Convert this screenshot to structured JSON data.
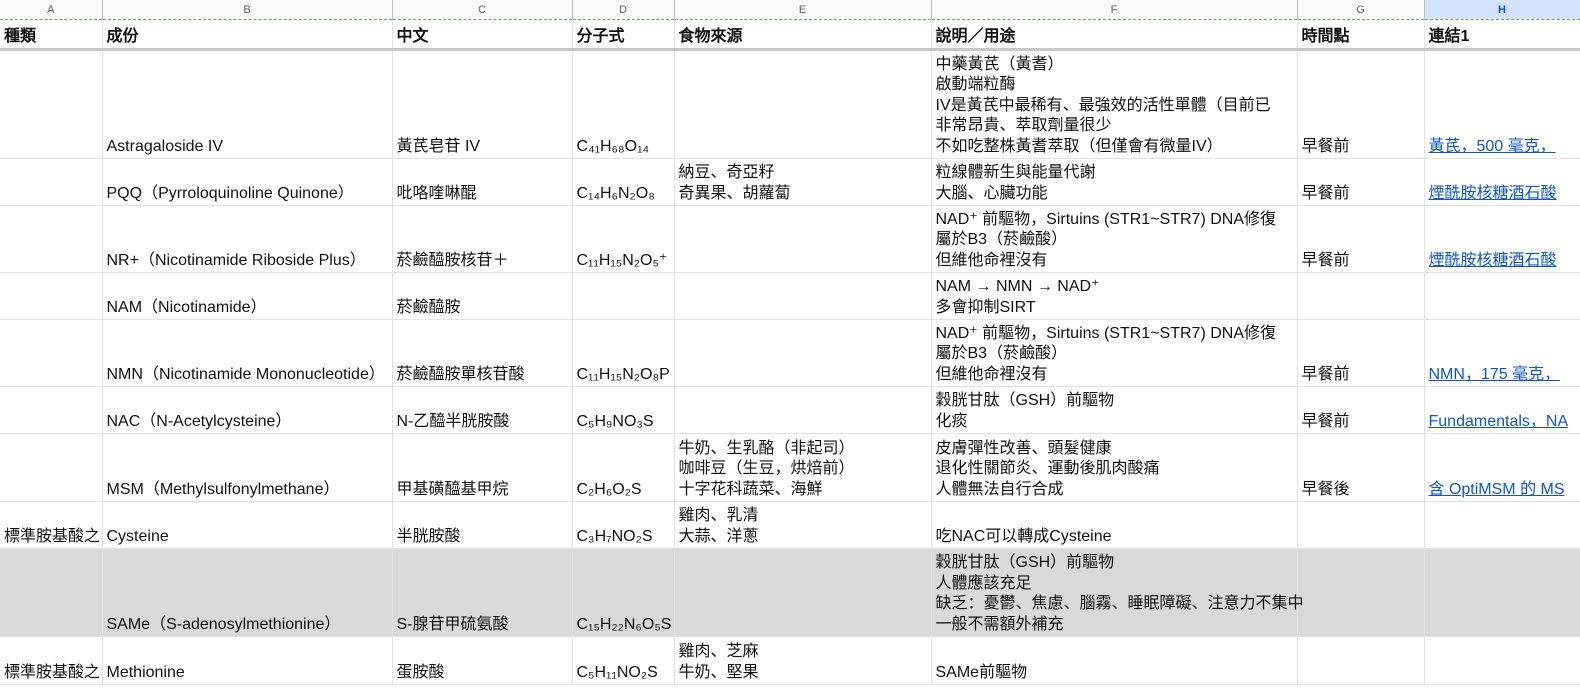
{
  "column_letters": [
    "A",
    "B",
    "C",
    "D",
    "E",
    "F",
    "G",
    "H"
  ],
  "headers": [
    "種類",
    "成份",
    "中文",
    "分子式",
    "食物來源",
    "說明／用途",
    "時間點",
    "連結1"
  ],
  "rows": [
    {
      "type": "",
      "ingredient": "Astragaloside IV",
      "chinese": "黃芪皂苷 IV",
      "formula": "C₄₁H₆₈O₁₄",
      "food": [],
      "desc": [
        "中藥黃芪（黃耆）",
        "啟動端粒酶",
        "IV是黃芪中最稀有、最強效的活性單體（目前已",
        "非常昂貴、萃取劑量很少",
        "不如吃整株黃耆萃取（但僅會有微量IV）"
      ],
      "timing": "早餐前",
      "link": "黃芪，500 毫克，"
    },
    {
      "type": "",
      "ingredient": "PQQ（Pyrroloquinoline Quinone）",
      "chinese": "吡咯喹啉醌",
      "formula": "C₁₄H₆N₂O₈",
      "food": [
        "納豆、奇亞籽",
        "奇異果、胡蘿蔔"
      ],
      "desc": [
        "粒線體新生與能量代謝",
        "大腦、心臟功能"
      ],
      "timing": "早餐前",
      "link": "煙酰胺核糖酒石酸"
    },
    {
      "type": "",
      "ingredient": "NR+（Nicotinamide Riboside Plus）",
      "chinese": "菸鹼醯胺核苷＋",
      "formula": "C₁₁H₁₅N₂O₅⁺",
      "food": [],
      "desc": [
        "NAD⁺ 前驅物，Sirtuins (STR1~STR7) DNA修復",
        "屬於B3（菸鹼酸）",
        "但維他命裡沒有"
      ],
      "timing": "早餐前",
      "link": "煙酰胺核糖酒石酸"
    },
    {
      "type": "",
      "ingredient": "NAM（Nicotinamide）",
      "chinese": "菸鹼醯胺",
      "formula": "",
      "food": [],
      "desc": [
        "NAM → NMN → NAD⁺",
        "多會抑制SIRT"
      ],
      "timing": "",
      "link": ""
    },
    {
      "type": "",
      "ingredient": "NMN（Nicotinamide Mononucleotide）",
      "chinese": "菸鹼醯胺單核苷酸",
      "formula": "C₁₁H₁₅N₂O₈P",
      "food": [],
      "desc": [
        "NAD⁺ 前驅物，Sirtuins (STR1~STR7) DNA修復",
        "屬於B3（菸鹼酸）",
        "但維他命裡沒有"
      ],
      "timing": "早餐前",
      "link": "NMN，175 毫克，"
    },
    {
      "type": "",
      "ingredient": "NAC（N-Acetylcysteine）",
      "chinese": "N-乙醯半胱胺酸",
      "formula": "C₅H₉NO₃S",
      "food": [],
      "desc": [
        "穀胱甘肽（GSH）前驅物",
        "化痰"
      ],
      "timing": "早餐前",
      "link": "Fundamentals，NA"
    },
    {
      "type": "",
      "ingredient": "MSM（Methylsulfonylmethane）",
      "chinese": "甲基磺醯基甲烷",
      "formula": "C₂H₆O₂S",
      "food": [
        "牛奶、生乳酪（非起司）",
        "咖啡豆（生豆，烘焙前）",
        "十字花科蔬菜、海鮮"
      ],
      "desc": [
        "皮膚彈性改善、頭髮健康",
        "退化性關節炎、運動後肌肉酸痛",
        "人體無法自行合成"
      ],
      "timing": "早餐後",
      "link": "含 OptiMSM 的 MS"
    },
    {
      "type": "標準胺基酸之",
      "ingredient": "Cysteine",
      "chinese": "半胱胺酸",
      "formula": "C₃H₇NO₂S",
      "food": [
        "雞肉、乳清",
        "大蒜、洋蔥"
      ],
      "desc": [
        "吃NAC可以轉成Cysteine"
      ],
      "timing": "",
      "link": ""
    },
    {
      "type": "",
      "ingredient": "SAMe（S-adenosylmethionine）",
      "chinese": "S-腺苷甲硫氨酸",
      "formula": "C₁₅H₂₂N₆O₅S",
      "food": [],
      "desc": [
        "穀胱甘肽（GSH）前驅物",
        "人體應該充足",
        "缺乏：憂鬱、焦慮、腦霧、睡眠障礙、注意力不集中",
        "一般不需額外補充"
      ],
      "timing": "",
      "link": ""
    },
    {
      "type": "標準胺基酸之",
      "ingredient": "Methionine",
      "chinese": "蛋胺酸",
      "formula": "C₅H₁₁NO₂S",
      "food": [
        "雞肉、芝麻",
        "牛奶、堅果"
      ],
      "desc": [
        "SAMe前驅物"
      ],
      "timing": "",
      "link": ""
    }
  ],
  "colors": {
    "selected_column_header": "#d3e3fd",
    "gray_row_fill": "#d9d9d9",
    "link": "#1155cc"
  }
}
